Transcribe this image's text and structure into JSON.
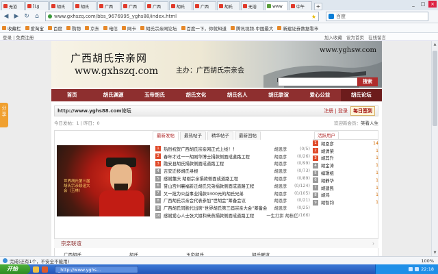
{
  "browser": {
    "tabs": [
      "无浴",
      "[Lg",
      "胡氏",
      "胡氏",
      "广西",
      "广西",
      "广西",
      "胡氏",
      "广西",
      "胡氏",
      "无浴",
      "www",
      "中午"
    ],
    "active_tab_index": 11,
    "url": "www.gxhszq.com/bbs_9676995_yghs88/index.html",
    "search_placeholder": "百度",
    "bookmarks": [
      "收藏栏",
      "爱淘宝",
      "百度",
      "购物",
      "京东",
      "电信",
      "网卡",
      "胡氏宗亲网论坛",
      "百度一下，你就知道",
      "腾讯视频-中国最大",
      "新建证券数据看市"
    ],
    "subbar_left": "登录 | 免费注册",
    "subbar_right": [
      "加入收藏",
      "设为首页",
      "在线留言"
    ],
    "status_text": "完成(还有1个，不安全不能用)",
    "zoom": "100%"
  },
  "banner": {
    "sitename": "广西胡氏宗亲网",
    "siteurl": "www.gxhszq.com",
    "host": "主办：广西胡氏宗亲会",
    "url_right": "www.yghsw.com",
    "search_button": "搜索"
  },
  "nav": {
    "items": [
      "首页",
      "胡氏渊源",
      "玉帝胡氏",
      "胡氏文化",
      "胡氏名人",
      "胡氏联谊",
      "爱心公益",
      "胡氏论坛"
    ],
    "active_index": 7
  },
  "forum": {
    "title": "http://www.yghs88.com论坛",
    "links": "注册 | 登录",
    "sign_button": "每日签到",
    "stats_left": "今日发帖：1 | 昨日：0",
    "stats_right_label": "欢迎新会员：",
    "stats_right_name": "笑看人生"
  },
  "content_tabs": [
    "最新发帖",
    "最热帖子",
    "精华帖子",
    "最新回帖"
  ],
  "photo_caption": "世界胡氏第三届胡氏宗亲联谊大会（玉林）",
  "topics": [
    {
      "n": "1",
      "title": "热烈祝贺广西胡氏宗亲网正式上线！！",
      "author": "胡恩彦",
      "count": "(0/5)"
    },
    {
      "n": "2",
      "title": "春年才过一一胡刚华博士捐款侧面成道路工程",
      "author": "胡恩彦",
      "count": "(0/26)"
    },
    {
      "n": "3",
      "title": "融安县胡氏捐款侧面成道路工程",
      "author": "胡恩彦",
      "count": "(0/99)"
    },
    {
      "n": "4",
      "title": "吉安迁移胡氏寻根",
      "author": "胡恩彦",
      "count": "(0/73)"
    },
    {
      "n": "5",
      "title": "感谢董庆 胡刚宗亲捐款侧面成道路工程",
      "author": "胡恩彦",
      "count": "(0/89)"
    },
    {
      "n": "6",
      "title": "誉山宫州襄福新迁胡氏兄弟捐款侧面成道路工程",
      "author": "胡恩彦",
      "count": "(0/124)"
    },
    {
      "n": "7",
      "title": "又一批为公益事业捐款9300元的胡氏兄弟",
      "author": "胡恩彦",
      "count": "(0/105)"
    },
    {
      "n": "8",
      "title": "广西胡氏宗亲会代表参加“世胡会”筹备会议",
      "author": "胡恩彦",
      "count": "(0/21)"
    },
    {
      "n": "9",
      "title": "广西胡氏同胞代出席“世界胡氏第三届宗亲大会”筹备会议",
      "author": "胡恩彦",
      "count": "(0/25)"
    },
    {
      "n": "10",
      "title": "感谢爱心人士张大姐和来燕捐款侧面成道路工程",
      "author": "一生打拼 胡栋仁",
      "count": "(0/166)"
    }
  ],
  "active_users_title": "活跃用户",
  "active_users": [
    {
      "n": "1",
      "name": "胡恩彦",
      "score": "14"
    },
    {
      "n": "2",
      "name": "胡清荣",
      "score": "1"
    },
    {
      "n": "3",
      "name": "胡其升",
      "score": "1"
    },
    {
      "n": "4",
      "name": "胡金涛",
      "score": "1"
    },
    {
      "n": "5",
      "name": "编辑组",
      "score": "1"
    },
    {
      "n": "6",
      "name": "胡静华",
      "score": "1"
    },
    {
      "n": "7",
      "name": "胡建民",
      "score": "1"
    },
    {
      "n": "8",
      "name": "胡鸿",
      "score": "1"
    },
    {
      "n": "9",
      "name": "胡智钧",
      "score": "1"
    }
  ],
  "section_title": "宗亲联谊",
  "gallery": [
    "广西胡氏",
    "胡氏",
    "玉帝胡氏",
    "胡氏联谊"
  ],
  "left_badge": "分享",
  "taskbar": {
    "start": "开始",
    "item": "_http://www.yghs...",
    "clock": "22:18"
  }
}
